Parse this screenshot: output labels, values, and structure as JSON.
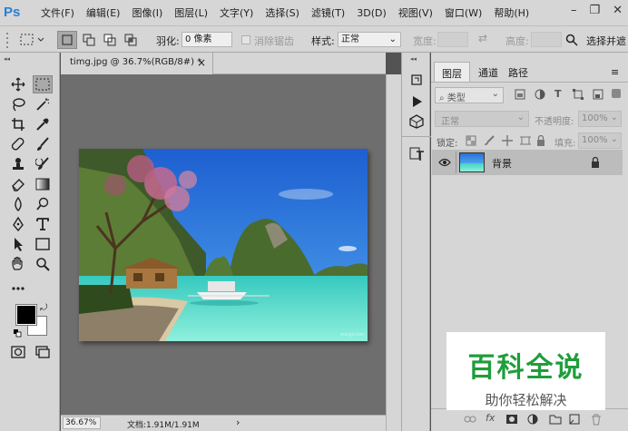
{
  "app": {
    "logo": "Ps"
  },
  "menu": [
    "文件(F)",
    "编辑(E)",
    "图像(I)",
    "图层(L)",
    "文字(Y)",
    "选择(S)",
    "滤镜(T)",
    "3D(D)",
    "视图(V)",
    "窗口(W)",
    "帮助(H)"
  ],
  "window_controls": {
    "minimize": "–",
    "restore": "❐",
    "close": "✕"
  },
  "options": {
    "feather_label": "羽化:",
    "feather_value": "0 像素",
    "antialias_label": "消除锯齿",
    "style_label": "样式:",
    "style_value": "正常",
    "width_label": "宽度:",
    "height_label": "高度:",
    "select_mask_button": "选择并遮"
  },
  "document": {
    "tab_title": "timg.jpg @ 36.7%(RGB/8#) *",
    "close": "×",
    "zoom": "36.67%",
    "doc_info": "文档:1.91M/1.91M",
    "arrow": "›"
  },
  "layers_panel": {
    "tabs": [
      "图层",
      "通道",
      "路径"
    ],
    "filter_placeholder": "类型",
    "blend_mode": "正常",
    "opacity_label": "不透明度:",
    "opacity_value": "100%",
    "lock_label": "锁定:",
    "fill_label": "填充:",
    "fill_value": "100%",
    "layer_name": "背景",
    "fx": "fx"
  },
  "watermark": {
    "title": "百科全说",
    "subtitle": "助你轻松解决"
  },
  "colors": {
    "accent": "#2a7fd4",
    "watermark_green": "#1f9d3b",
    "canvas_bg": "#6e6e6e"
  }
}
